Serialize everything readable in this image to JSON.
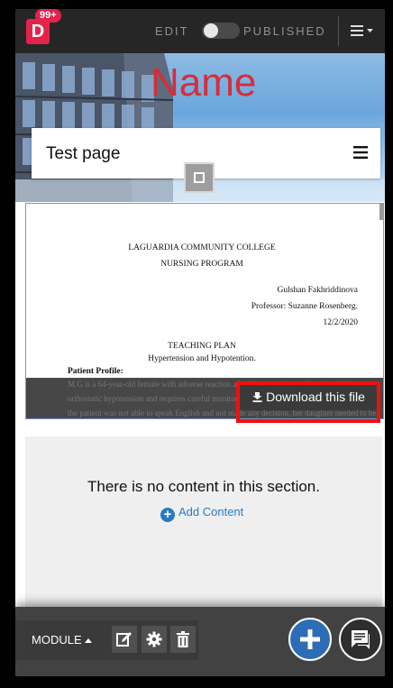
{
  "app": {
    "notification_count": "99+",
    "logo_letter": "D",
    "edit_label": "EDIT",
    "published_label": "PUBLISHED"
  },
  "hero": {
    "site_name": "Name",
    "page_title": "Test page"
  },
  "document": {
    "lines": {
      "college": "LAGUARDIA COMMUNITY COLLEGE",
      "program": "NURSING PROGRAM",
      "author": "Gulshan Fakhriddinova",
      "professor": "Professor: Suzanne Rosenberg.",
      "date": "12/2/2020",
      "heading": "TEACHING PLAN",
      "subheading": "Hypertension and Hypotention.",
      "profile_label": "Patient Profile:",
      "body1": "M.G is a 64-year-old female with adverse reaction after hypertension medication, she has",
      "body2": "orthostatic hypotension and requires careful monitoring of the patient's blood pressure,",
      "body3": "the patient was not able to speak English and not made any decision, her daughter needed to be"
    },
    "download_label": "Download this file"
  },
  "section2": {
    "empty_message": "There is no content in this section.",
    "add_content_label": "Add Content"
  },
  "toolbar": {
    "module_label": "MODULE"
  },
  "colors": {
    "brand_red": "#e4234a",
    "site_name_red": "#d72d38",
    "accent_blue": "#2d6db5",
    "highlight_red": "#ee1111"
  }
}
